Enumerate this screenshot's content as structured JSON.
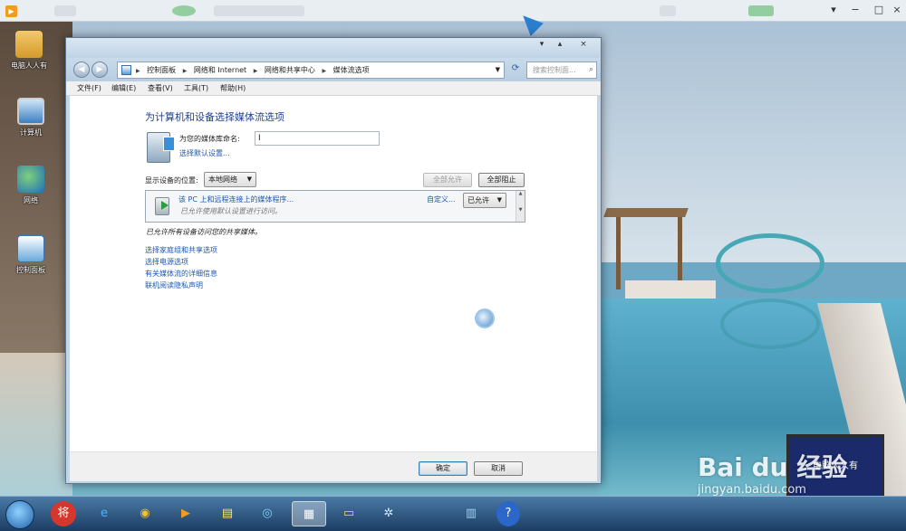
{
  "desktop": {
    "icons": [
      {
        "label": "电脑人人有"
      },
      {
        "label": "计算机"
      },
      {
        "label": "网络"
      },
      {
        "label": "控制面板"
      }
    ]
  },
  "window": {
    "address": {
      "crumbs": [
        "控制面板",
        "网络和 Internet",
        "网络和共享中心",
        "媒体流选项"
      ],
      "search_placeholder": "搜索控制面..."
    },
    "menu": [
      "文件(F)",
      "编辑(E)",
      "查看(V)",
      "工具(T)",
      "帮助(H)"
    ],
    "heading": "为计算机和设备选择媒体流选项",
    "library_name_label": "为您的媒体库命名:",
    "library_name_value": "I",
    "choose_defaults_link": "选择默认设置...",
    "show_devices_label": "显示设备的位置:",
    "show_devices_value": "本地网络",
    "allow_all_button": "全部允许",
    "block_all_button": "全部阻止",
    "device": {
      "name": "该 PC 上和远程连接上的媒体程序...",
      "desc": "已允许使用默认设置进行访问。",
      "customize": "自定义...",
      "status": "已允许"
    },
    "all_allowed_text": "已允许所有设备访问您的共享媒体。",
    "links": [
      "选择家庭组和共享选项",
      "选择电源选项",
      "有关媒体流的详细信息",
      "联机阅读隐私声明"
    ],
    "ok_button": "确定",
    "cancel_button": "取消"
  },
  "watermark": {
    "brand": "Bai du 经验",
    "url": "jingyan.baidu.com",
    "screen_text": "电脑人人有"
  },
  "taskbar": {
    "items": [
      {
        "icon": "chess-icon",
        "glyph": "将"
      },
      {
        "icon": "ie-icon",
        "glyph": "e"
      },
      {
        "icon": "chrome-icon",
        "glyph": "◉"
      },
      {
        "icon": "media-player-icon",
        "glyph": "▶"
      },
      {
        "icon": "notes-icon",
        "glyph": "▤"
      },
      {
        "icon": "browser-icon",
        "glyph": "◎"
      },
      {
        "icon": "control-panel-icon",
        "glyph": "▦"
      },
      {
        "icon": "explorer-icon",
        "glyph": "▭"
      },
      {
        "icon": "tool-icon",
        "glyph": "✲"
      },
      {
        "icon": "book-icon",
        "glyph": "▥"
      },
      {
        "icon": "help-icon",
        "glyph": "?"
      }
    ]
  }
}
